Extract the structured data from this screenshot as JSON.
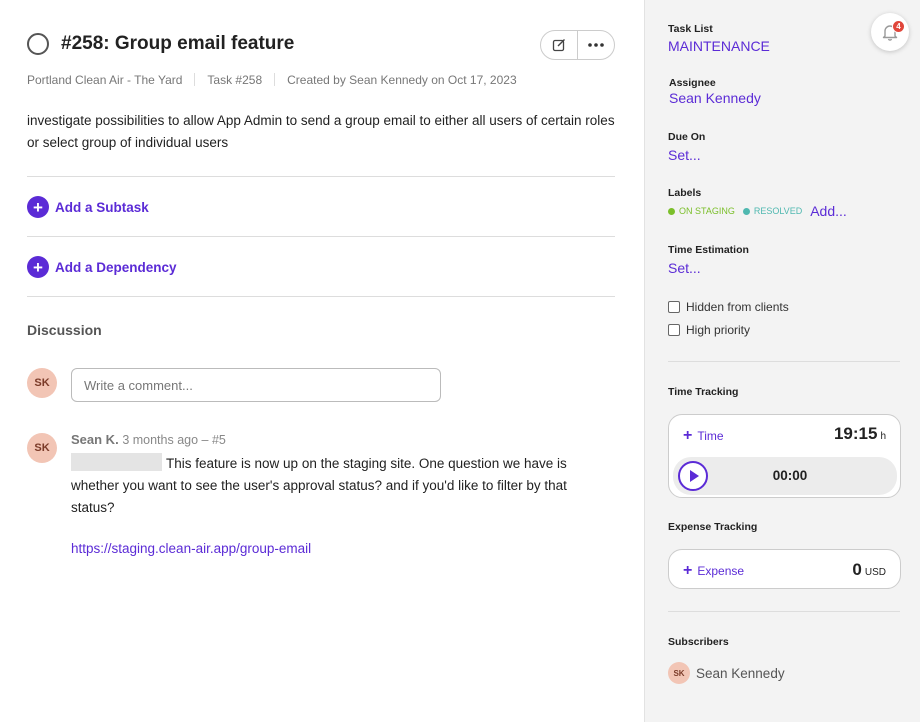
{
  "task": {
    "title": "#258: Group email feature",
    "project": "Portland Clean Air - The Yard",
    "task_number": "Task #258",
    "created": "Created by Sean Kennedy on Oct 17, 2023",
    "description": "investigate possibilities to allow App Admin to send a group email to either all users of certain roles or select group of individual users"
  },
  "actions": {
    "add_subtask": "Add a Subtask",
    "add_dependency": "Add a Dependency"
  },
  "discussion": {
    "heading": "Discussion",
    "comment_placeholder": "Write a comment...",
    "current_user_initials": "SK",
    "comments": [
      {
        "initials": "SK",
        "author": "Sean K.",
        "meta": "3 months ago – #5",
        "body": "This feature is now up on the staging site. One question we have is whether you want to see the user's approval status? and if you'd like to filter by that status?",
        "link": "https://staging.clean-air.app/group-email"
      }
    ]
  },
  "sidebar": {
    "task_list_label": "Task List",
    "task_list_value": "MAINTENANCE",
    "assignee_label": "Assignee",
    "assignee_value": "Sean Kennedy",
    "due_label": "Due On",
    "due_value": "Set...",
    "labels_label": "Labels",
    "labels": [
      {
        "text": "ON STAGING",
        "color": "#7bbf2a"
      },
      {
        "text": "RESOLVED",
        "color": "#4fb8b0"
      }
    ],
    "labels_add": "Add...",
    "estimation_label": "Time Estimation",
    "estimation_value": "Set...",
    "hidden_label": "Hidden from clients",
    "priority_label": "High priority",
    "time_tracking_label": "Time Tracking",
    "time_add": "Time",
    "time_total": "19:15",
    "time_unit": "h",
    "timer_value": "00:00",
    "expense_label": "Expense Tracking",
    "expense_add": "Expense",
    "expense_total": "0",
    "expense_currency": "USD",
    "subscribers_label": "Subscribers",
    "subscriber_initials": "SK",
    "subscriber_name": "Sean Kennedy"
  },
  "notifications": {
    "count": "4"
  },
  "colors": {
    "accent": "#5b2bd6",
    "badge": "#e0463b"
  }
}
